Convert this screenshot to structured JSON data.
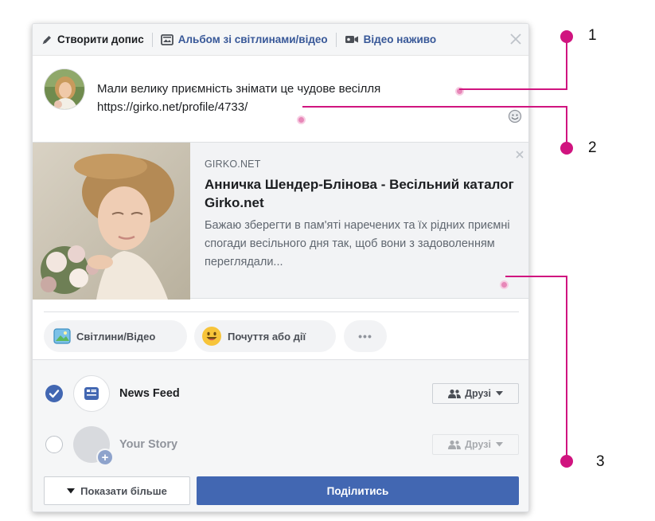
{
  "tabs": {
    "create_post": "Створити допис",
    "album": "Альбом зі світлинами/відео",
    "live_video": "Відео наживо"
  },
  "status": {
    "line1": "Мали велику приємність знімати це чудове весілля",
    "line2": "https://girko.net/profile/4733/"
  },
  "preview": {
    "domain": "GIRKO.NET",
    "title": "Анничка Шендер-Блінова - Весільний каталог Girko.net",
    "description": "Бажаю зберегти в пам'яті наречених та їх рідних приємні спогади весільного дня так, щоб вони з задоволенням переглядали..."
  },
  "actions": {
    "photo_video": "Світлини/Відео",
    "feeling": "Почуття або дії",
    "more": "•••"
  },
  "audience": {
    "news_feed_label": "News Feed",
    "news_feed_audience": "Друзі",
    "story_label": "Your Story",
    "story_audience": "Друзі",
    "news_feed_checked": true,
    "story_checked": false
  },
  "footer": {
    "show_more": "Показати більше",
    "share": "Поділитись"
  },
  "callouts": [
    "1",
    "2",
    "3"
  ],
  "colors": {
    "brand_blue": "#4267b2",
    "link_blue": "#385898",
    "callout_magenta": "#d0147f"
  }
}
